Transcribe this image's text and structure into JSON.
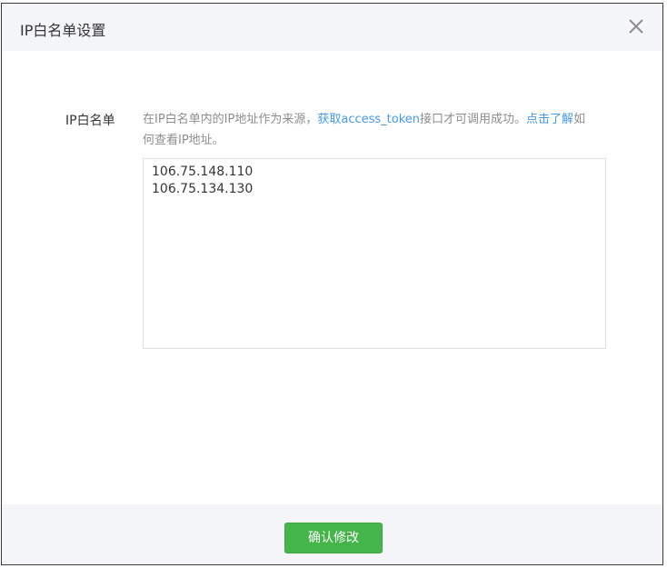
{
  "dialog": {
    "title": "IP白名单设置",
    "close_label": "×"
  },
  "form": {
    "label": "IP白名单",
    "tip": {
      "part1": "在IP白名单内的IP地址作为来源，",
      "link1": "获取access_token",
      "part2": "接口才可调用成功。",
      "link2": "点击了解",
      "part3": "如何查看IP地址。"
    },
    "ip_list": "106.75.148.110\n106.75.134.130"
  },
  "footer": {
    "confirm_label": "确认修改"
  },
  "colors": {
    "accent_green": "#44b549",
    "link_blue": "#459ae9",
    "header_bg": "#f4f5f9"
  }
}
